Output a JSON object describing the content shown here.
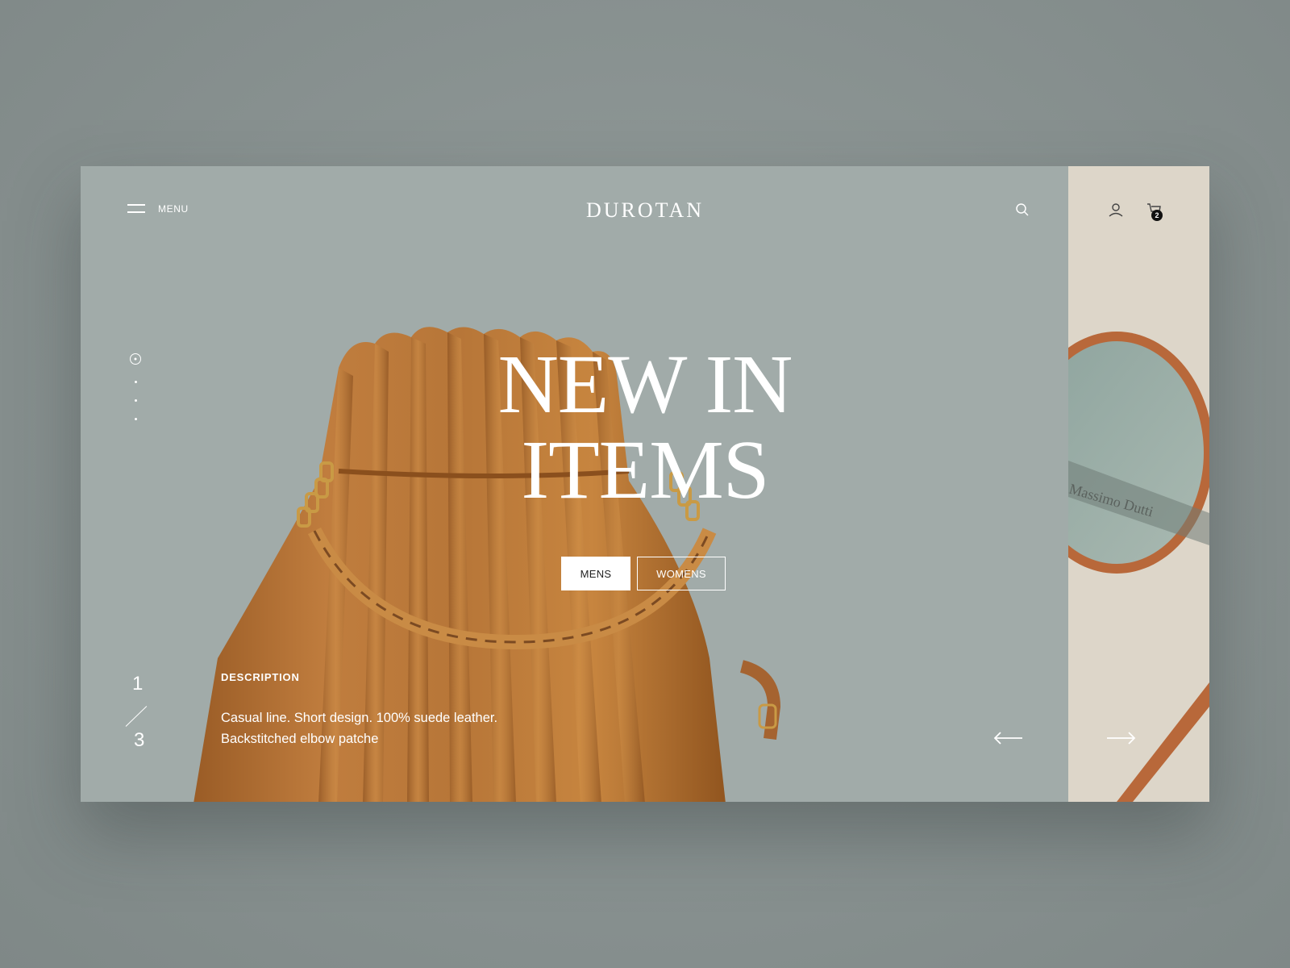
{
  "header": {
    "menu_label": "MENU",
    "brand": "DUROTAN",
    "cart_count": "2",
    "icons": [
      "hamburger-icon",
      "search-icon",
      "user-icon",
      "cart-icon"
    ]
  },
  "hero": {
    "headline_line1": "NEW IN",
    "headline_line2": "ITEMS",
    "buttons": {
      "mens": "MENS",
      "womens": "WOMENS"
    }
  },
  "slider": {
    "current": "1",
    "total": "3",
    "dots_count": 4
  },
  "description": {
    "title": "DESCRIPTION",
    "line1": "Casual line. Short design. 100% suede leather.",
    "line2": "Backstitched elbow patche"
  },
  "navigation": {
    "prev_icon": "arrow-left-icon",
    "next_icon": "arrow-right-icon"
  },
  "side_panel": {
    "product_text": "Massimo Dutti"
  },
  "colors": {
    "page_bg": "#8a9391",
    "hero_bg": "#a1aba9",
    "side_bg": "#ddd6c9",
    "bag_leather": "#b37236",
    "text": "#ffffff"
  }
}
